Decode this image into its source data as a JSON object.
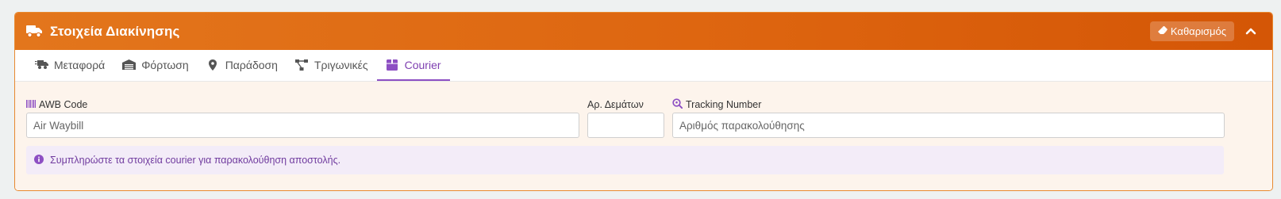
{
  "header": {
    "title": "Στοιχεία Διακίνησης",
    "clear_label": "Καθαρισμός",
    "brand_color": "#dd640f"
  },
  "tabs": [
    {
      "label": "Μεταφορά",
      "icon": "truck-fast-icon",
      "active": false
    },
    {
      "label": "Φόρτωση",
      "icon": "warehouse-icon",
      "active": false
    },
    {
      "label": "Παράδοση",
      "icon": "map-pin-icon",
      "active": false
    },
    {
      "label": "Τριγωνικές",
      "icon": "triangle-network-icon",
      "active": false
    },
    {
      "label": "Courier",
      "icon": "box-icon",
      "active": true
    }
  ],
  "fields": {
    "awb": {
      "label": "AWB Code",
      "placeholder": "Air Waybill",
      "value": ""
    },
    "bundles": {
      "label": "Αρ. Δεμάτων",
      "placeholder": "",
      "value": ""
    },
    "tracking": {
      "label": "Tracking Number",
      "placeholder": "Αριθμός παρακολούθησης",
      "value": ""
    }
  },
  "info": {
    "text": "Συμπληρώστε τα στοιχεία courier για παρακολούθηση αποστολής."
  },
  "colors": {
    "accent_purple": "#8d4fc3",
    "body_bg": "#fdf4ec",
    "info_bg": "#f3ecf8"
  }
}
